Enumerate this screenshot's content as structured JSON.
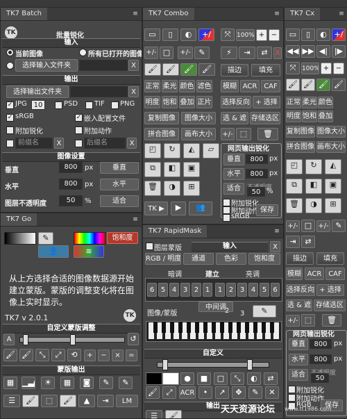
{
  "batch": {
    "tab": "TK7 Batch",
    "title": "批量锐化",
    "input_section": "输入",
    "radio_current": "当前图像",
    "radio_all_open": "所有已打开的图像",
    "choose_input": "选择输入文件夹",
    "output_section": "输出",
    "choose_output": "选择输出文件夹",
    "clear": "X",
    "fmt_jpg": "JPG",
    "jpg_quality": "10",
    "fmt_psd": "PSD",
    "fmt_tif": "TIF",
    "fmt_png": "PNG",
    "srgb": "sRGB",
    "embed_profile": "嵌入配置文件",
    "add_sharpen": "附加锐化",
    "add_action": "附加动作",
    "prefix_ph": "前缀名",
    "suffix_ph": "后缀名",
    "image_settings": "图像设置",
    "vertical": "垂直",
    "vertical_value": "800",
    "px": "px",
    "btn_vertical": "垂直",
    "horizontal": "水平",
    "horizontal_value": "800",
    "btn_horizontal": "水平",
    "opacity_label": "图层不透明度",
    "opacity_value": "50",
    "percent": "%",
    "btn_fit": "适合"
  },
  "go": {
    "tab": "TK7 Go",
    "saturation": "饱和度",
    "description": "从上方选择合适的图像数据源开始建立蒙版。蒙版的调整变化将在图像上实时显示。",
    "version": "TK7 v 2.0.1",
    "custom_adjust": "自定义蒙版调整",
    "btn_a": "A",
    "btn_plus": "+",
    "btn_minus": "−",
    "btn_x": "×",
    "btn_eq": "=",
    "mask_output": "蒙版输出",
    "btn_lm": "LM"
  },
  "combo": {
    "tab": "TK7 Combo",
    "zoom": "100%",
    "btn_plus": "+",
    "btn_minus": "−",
    "btn_x": "X",
    "btn_plusdiv": "+/-",
    "stroke": "描边",
    "fill": "填充",
    "normal": "正常",
    "soft": "柔光",
    "color": "颜色",
    "filter": "滤色",
    "brightness": "明度",
    "saturation": "饱和",
    "overlay": "叠加",
    "multiply": "正片",
    "blur": "模糊",
    "acr": "ACR",
    "caf": "CAF",
    "select_inverse": "选择反向",
    "plus_select": "+ 选择",
    "select_and_mask": "选 & 遮",
    "save_selection": "存储选区",
    "copy_image": "复制图像",
    "image_size": "图像大小",
    "merge_image": "拼合图像",
    "canvas_size": "画布大小",
    "web_output": "网页输出锐化",
    "vertical": "垂直",
    "vertical_value": "800",
    "px": "px",
    "horizontal": "水平",
    "horizontal_value": "800",
    "fit": "适合",
    "opacity_hint": "不透明度",
    "opacity_value": "50",
    "percent": "%",
    "add_sharpen": "附加锐化",
    "add_action": "附加动作",
    "srgb": "sRGB",
    "save": "保存",
    "tk_btn": "TK ▶"
  },
  "rapid": {
    "tab": "TK7 RapidMask",
    "layer_mask": "图层蒙版",
    "input": "输入",
    "rgb_brightness": "RGB / 明度",
    "channel": "通道",
    "color": "色彩",
    "saturation": "饱和度",
    "darks": "暗调",
    "build": "建立",
    "lights": "亮调",
    "mids": "中间调",
    "nums": [
      "6",
      "5",
      "4",
      "3",
      "2",
      "1",
      "1",
      "2",
      "3",
      "4",
      "5",
      "6"
    ],
    "image_mask": "图像/蒙版",
    "num_2": "2",
    "num_3": "3",
    "custom": "自定义",
    "acr": "ACR",
    "output": "输出"
  },
  "cx": {
    "tab": "TK7 Cx",
    "zoom": "100%",
    "stroke": "描边",
    "fill": "填充",
    "normal": "正常",
    "soft": "柔光",
    "color": "颜色",
    "brightness": "明度",
    "saturation": "饱和",
    "overlay": "叠加",
    "blur": "模糊",
    "acr": "ACR",
    "caf": "CAF",
    "copy_image": "复制图像",
    "image_size": "图像大小",
    "merge_image": "拼合图像",
    "canvas_size": "画布大小",
    "select_inverse": "选择反向",
    "plus_select": "+ 选择",
    "select_and_mask": "选 & 遮",
    "save_selection": "存储选区",
    "plusdiv": "+/-",
    "web_output": "网页输出锐化",
    "vertical": "垂直",
    "vertical_value": "800",
    "px": "px",
    "horizontal": "水平",
    "horizontal_value": "800",
    "fit": "适合",
    "opacity_hint": "不透明度",
    "opacity_value": "50",
    "add_sharpen": "附加锐化",
    "add_action": "附加动作",
    "rgb": "RGB",
    "save": "保存"
  },
  "watermark": {
    "site": "天天资源论坛",
    "url": "www.tt1986.com"
  }
}
